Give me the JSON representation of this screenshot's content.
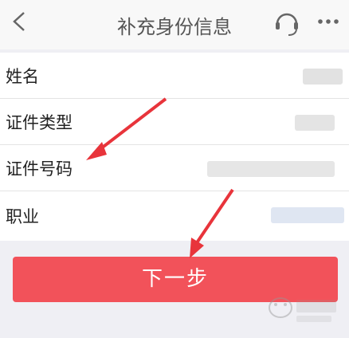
{
  "header": {
    "title": "补充身份信息",
    "back_icon": "chevron-left-icon",
    "support_icon": "headset-icon",
    "more_icon": "ellipsis-icon"
  },
  "form": {
    "rows": [
      {
        "label": "姓名",
        "value_state": "blurred"
      },
      {
        "label": "证件类型",
        "value_state": "blurred"
      },
      {
        "label": "证件号码",
        "value_state": "blurred"
      },
      {
        "label": "职业",
        "value_state": "blurred"
      }
    ]
  },
  "actions": {
    "next_label": "下一步"
  },
  "colors": {
    "accent": "#f2525a",
    "arrow": "#e8343b",
    "background": "#efeff4"
  }
}
